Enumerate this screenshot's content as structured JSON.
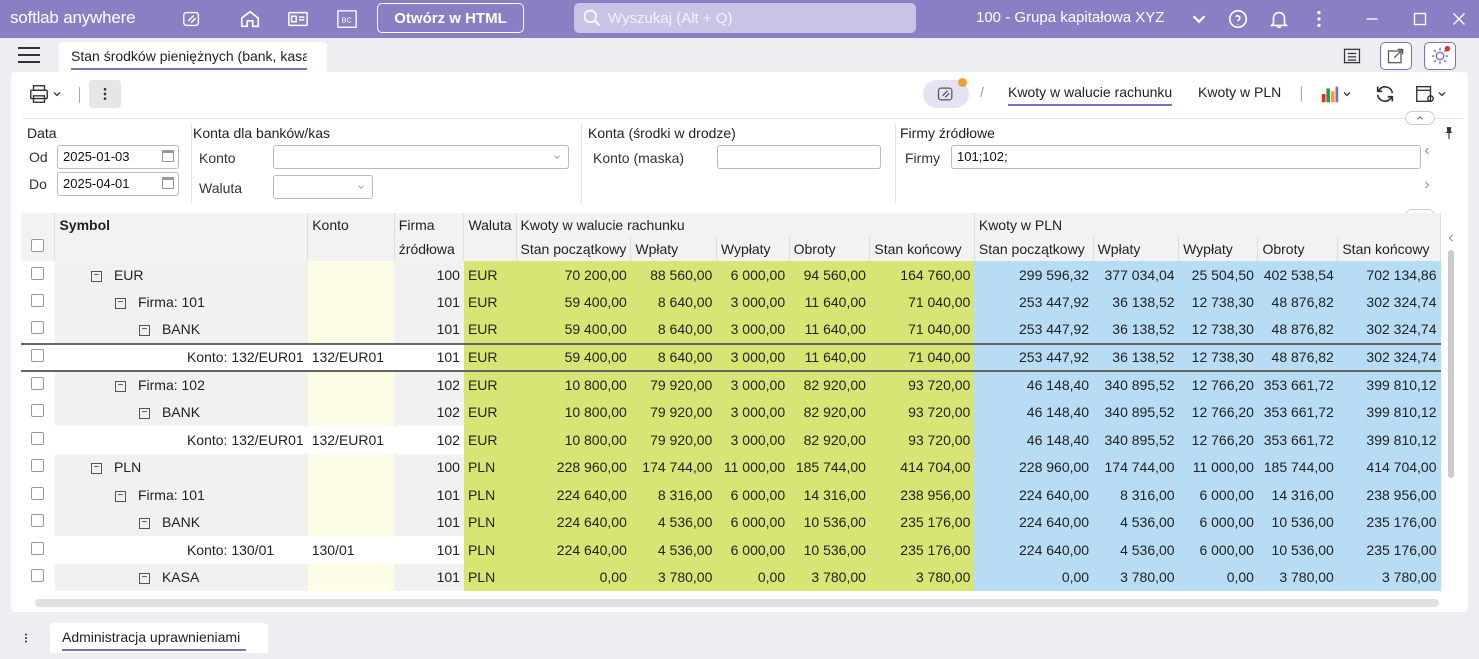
{
  "app": {
    "brand": "softlab anywhere",
    "open_html_label": "Otwórz w HTML",
    "search_placeholder": "Wyszukaj (Alt + Q)",
    "company": "100 - Grupa kapitałowa XYZ"
  },
  "tabs": {
    "active": "Stan środków pieniężnych (bank, kasa)",
    "bottom": "Administracja uprawnieniami"
  },
  "toolbar": {
    "view_tab_1": "Kwoty w walucie rachunku",
    "view_tab_2": "Kwoty w PLN",
    "sep": "/"
  },
  "filters": {
    "data": {
      "title": "Data",
      "od_label": "Od",
      "od_value": "2025-01-03",
      "do_label": "Do",
      "do_value": "2025-04-01"
    },
    "konta_bankow": {
      "title": "Konta dla banków/kas",
      "konto_label": "Konto",
      "waluta_label": "Waluta"
    },
    "konta_drodze": {
      "title": "Konta (środki w drodze)",
      "label": "Konto (maska)"
    },
    "firmy": {
      "title": "Firmy źródłowe",
      "label": "Firmy",
      "value": "101;102;"
    }
  },
  "grid": {
    "headers": {
      "symbol": "Symbol",
      "konto": "Konto",
      "firma_1": "Firma",
      "firma_2": "źródłowa",
      "waluta": "Waluta",
      "group_rach": "Kwoty w walucie rachunku",
      "group_pln": "Kwoty w PLN",
      "stan_pocz": "Stan początkowy",
      "wplaty": "Wpłaty",
      "wyplaty": "Wypłaty",
      "obroty": "Obroty",
      "stan_konc": "Stan końcowy"
    },
    "rows": [
      {
        "symbol": "EUR",
        "level": 0,
        "expander": true,
        "konto": "",
        "firma": "100",
        "waluta": "EUR",
        "r": [
          "70 200,00",
          "88 560,00",
          "6 000,00",
          "94 560,00",
          "164 760,00"
        ],
        "p": [
          "299 596,32",
          "377 034,04",
          "25 504,50",
          "402 538,54",
          "702 134,86"
        ]
      },
      {
        "symbol": "Firma: 101",
        "level": 1,
        "expander": true,
        "konto": "",
        "firma": "101",
        "waluta": "EUR",
        "r": [
          "59 400,00",
          "8 640,00",
          "3 000,00",
          "11 640,00",
          "71 040,00"
        ],
        "p": [
          "253 447,92",
          "36 138,52",
          "12 738,30",
          "48 876,82",
          "302 324,74"
        ]
      },
      {
        "symbol": "BANK",
        "level": 2,
        "expander": true,
        "konto": "",
        "firma": "101",
        "waluta": "EUR",
        "r": [
          "59 400,00",
          "8 640,00",
          "3 000,00",
          "11 640,00",
          "71 040,00"
        ],
        "p": [
          "253 447,92",
          "36 138,52",
          "12 738,30",
          "48 876,82",
          "302 324,74"
        ]
      },
      {
        "symbol": "Konto: 132/EUR01",
        "level": 3,
        "expander": false,
        "selected": true,
        "konto": "132/EUR01",
        "firma": "101",
        "waluta": "EUR",
        "r": [
          "59 400,00",
          "8 640,00",
          "3 000,00",
          "11 640,00",
          "71 040,00"
        ],
        "p": [
          "253 447,92",
          "36 138,52",
          "12 738,30",
          "48 876,82",
          "302 324,74"
        ]
      },
      {
        "symbol": "Firma: 102",
        "level": 1,
        "expander": true,
        "konto": "",
        "firma": "102",
        "waluta": "EUR",
        "r": [
          "10 800,00",
          "79 920,00",
          "3 000,00",
          "82 920,00",
          "93 720,00"
        ],
        "p": [
          "46 148,40",
          "340 895,52",
          "12 766,20",
          "353 661,72",
          "399 810,12"
        ]
      },
      {
        "symbol": "BANK",
        "level": 2,
        "expander": true,
        "konto": "",
        "firma": "102",
        "waluta": "EUR",
        "r": [
          "10 800,00",
          "79 920,00",
          "3 000,00",
          "82 920,00",
          "93 720,00"
        ],
        "p": [
          "46 148,40",
          "340 895,52",
          "12 766,20",
          "353 661,72",
          "399 810,12"
        ]
      },
      {
        "symbol": "Konto: 132/EUR01",
        "level": 3,
        "expander": false,
        "konto": "132/EUR01",
        "firma": "102",
        "waluta": "EUR",
        "r": [
          "10 800,00",
          "79 920,00",
          "3 000,00",
          "82 920,00",
          "93 720,00"
        ],
        "p": [
          "46 148,40",
          "340 895,52",
          "12 766,20",
          "353 661,72",
          "399 810,12"
        ]
      },
      {
        "symbol": "PLN",
        "level": 0,
        "expander": true,
        "konto": "",
        "firma": "100",
        "waluta": "PLN",
        "r": [
          "228 960,00",
          "174 744,00",
          "11 000,00",
          "185 744,00",
          "414 704,00"
        ],
        "p": [
          "228 960,00",
          "174 744,00",
          "11 000,00",
          "185 744,00",
          "414 704,00"
        ]
      },
      {
        "symbol": "Firma: 101",
        "level": 1,
        "expander": true,
        "konto": "",
        "firma": "101",
        "waluta": "PLN",
        "r": [
          "224 640,00",
          "8 316,00",
          "6 000,00",
          "14 316,00",
          "238 956,00"
        ],
        "p": [
          "224 640,00",
          "8 316,00",
          "6 000,00",
          "14 316,00",
          "238 956,00"
        ]
      },
      {
        "symbol": "BANK",
        "level": 2,
        "expander": true,
        "konto": "",
        "firma": "101",
        "waluta": "PLN",
        "r": [
          "224 640,00",
          "4 536,00",
          "6 000,00",
          "10 536,00",
          "235 176,00"
        ],
        "p": [
          "224 640,00",
          "4 536,00",
          "6 000,00",
          "10 536,00",
          "235 176,00"
        ]
      },
      {
        "symbol": "Konto: 130/01",
        "level": 3,
        "expander": false,
        "konto": "130/01",
        "firma": "101",
        "waluta": "PLN",
        "r": [
          "224 640,00",
          "4 536,00",
          "6 000,00",
          "10 536,00",
          "235 176,00"
        ],
        "p": [
          "224 640,00",
          "4 536,00",
          "6 000,00",
          "10 536,00",
          "235 176,00"
        ]
      },
      {
        "symbol": "KASA",
        "level": 2,
        "expander": true,
        "konto": "",
        "firma": "101",
        "waluta": "PLN",
        "r": [
          "0,00",
          "3 780,00",
          "0,00",
          "3 780,00",
          "3 780,00"
        ],
        "p": [
          "0,00",
          "3 780,00",
          "0,00",
          "3 780,00",
          "3 780,00"
        ]
      }
    ]
  },
  "colors": {
    "topbar": "#8a7fc4",
    "accent": "#7b6fc0",
    "green_cells": "#d8e574",
    "blue_cells": "#b7dcf4",
    "yellow_cells": "#fdfde5",
    "badge_dot": "#f0a030",
    "alert_dot": "#e0302a"
  }
}
